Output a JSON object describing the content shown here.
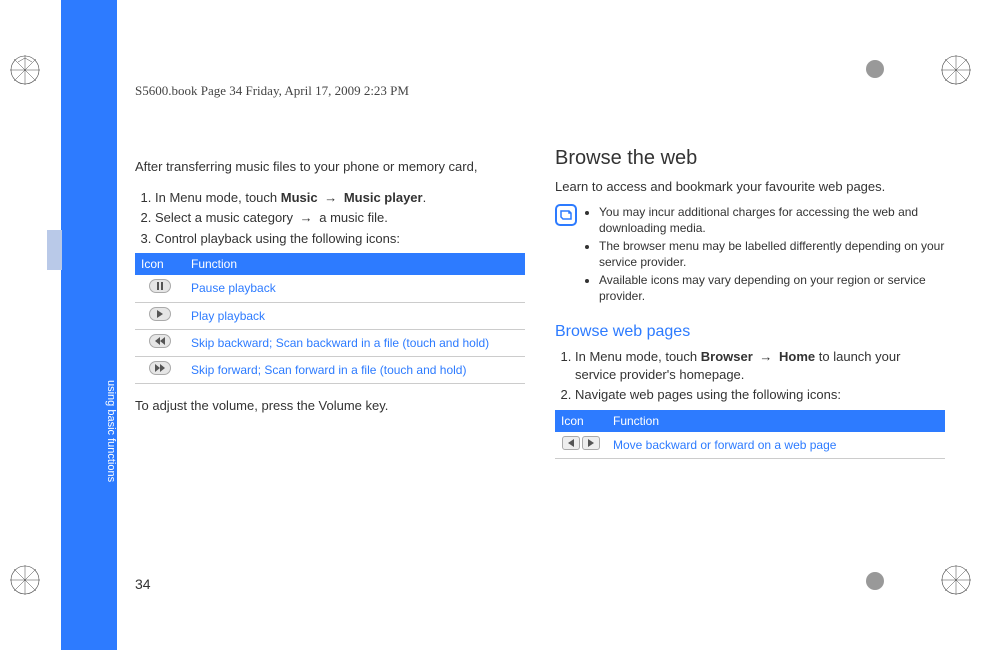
{
  "header": "S5600.book  Page 34  Friday, April 17, 2009  2:23 PM",
  "pageNumber": "34",
  "sideLabel": "using basic functions",
  "left": {
    "intro": "After transferring music files to your phone or memory card,",
    "steps": [
      {
        "pre": "In Menu mode, touch ",
        "b1": "Music",
        "arrow": "→",
        "b2": "Music player",
        "post": "."
      },
      {
        "pre": "Select a music category ",
        "arrow": "→",
        "post": " a music file."
      },
      {
        "pre": "Control playback using the following icons:",
        "arrow": "",
        "post": ""
      }
    ],
    "tableHead": {
      "icon": "Icon",
      "func": "Function"
    },
    "rows": [
      {
        "func": "Pause playback"
      },
      {
        "func": "Play playback"
      },
      {
        "func": "Skip backward; Scan backward in a file (touch and hold)"
      },
      {
        "func": "Skip forward; Scan forward in a file (touch and hold)"
      }
    ],
    "after": "To adjust the volume, press the Volume key."
  },
  "right": {
    "h2": "Browse the web",
    "intro": "Learn to access and bookmark your favourite web pages.",
    "notes": [
      "You may incur additional charges for accessing the web and downloading media.",
      "The browser menu may be labelled differently depending on your service provider.",
      "Available icons may vary depending on your region or service provider."
    ],
    "subhead": "Browse web pages",
    "steps": [
      {
        "pre": "In Menu mode, touch ",
        "b1": "Browser",
        "arrow": "→",
        "b2": "Home",
        "post": " to launch your service provider's homepage."
      },
      {
        "pre": "Navigate web pages using the following icons:",
        "arrow": "",
        "post": ""
      }
    ],
    "tableHead": {
      "icon": "Icon",
      "func": "Function"
    },
    "rows": [
      {
        "func": "Move backward or forward on a web page"
      }
    ]
  }
}
